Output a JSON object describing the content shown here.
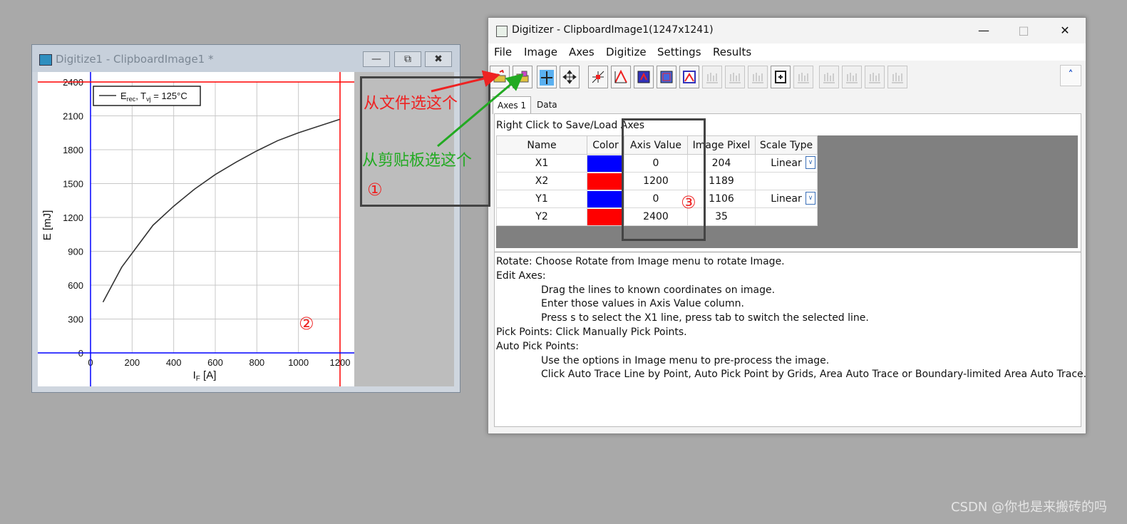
{
  "child_window": {
    "title": "Digitize1 - ClipboardImage1 *",
    "buttons": [
      {
        "name": "minimize",
        "glyph": "—"
      },
      {
        "name": "restore",
        "glyph": "⧉"
      },
      {
        "name": "close",
        "glyph": "✖"
      }
    ]
  },
  "chart_data": {
    "type": "line",
    "series": [
      {
        "name": "E_rec, T_vj = 125°C",
        "x": [
          60,
          150,
          300,
          400,
          500,
          600,
          700,
          800,
          900,
          1000,
          1100,
          1200
        ],
        "y": [
          450,
          760,
          1130,
          1300,
          1450,
          1580,
          1690,
          1790,
          1880,
          1950,
          2010,
          2070
        ]
      }
    ],
    "legend": {
      "text_main": "E",
      "sub1": "rec",
      "text_mid": ", T",
      "sub2": "vj",
      "text_end": " = 125°C",
      "position": "top-left"
    },
    "xlabel": {
      "main": "I",
      "sub": "F",
      "rest": " [A]"
    },
    "ylabel": "E [mJ]",
    "xlim": [
      0,
      1200
    ],
    "ylim": [
      0,
      2400
    ],
    "x_ticks": [
      "0",
      "200",
      "400",
      "600",
      "800",
      "1000",
      "1200"
    ],
    "y_ticks": [
      "0",
      "300",
      "600",
      "900",
      "1200",
      "1500",
      "1800",
      "2100",
      "2400"
    ],
    "grid": true,
    "line_color": "#333333",
    "axis_line_colors": {
      "x1": "#0000ff",
      "x2": "#ff0000",
      "y1": "#0000ff",
      "y2": "#ff0000"
    }
  },
  "main_window": {
    "title": "Digitizer - ClipboardImage1(1247x1241)",
    "window_controls": {
      "minimize": "—",
      "maximize": "□",
      "close": "✕"
    },
    "menu": [
      "File",
      "Image",
      "Axes",
      "Digitize",
      "Settings",
      "Results"
    ],
    "toolbar_icons": [
      "open-file-icon",
      "paste-clipboard-icon",
      "edit-axes-icon",
      "move-axes-icon",
      "manual-pick-icon",
      "auto-trace-icon",
      "pick-grid-icon",
      "area-trace-icon",
      "boundary-trace-icon",
      "disabled-icon-1",
      "disabled-icon-2",
      "disabled-icon-3",
      "fit-page-icon",
      "disabled-icon-4",
      "disabled-icon-5",
      "disabled-icon-6",
      "disabled-icon-7",
      "disabled-icon-8"
    ],
    "collapse_glyph": "˄",
    "tabs": [
      "Axes 1",
      "Data"
    ],
    "hint": "Right Click to Save/Load Axes",
    "table": {
      "headers": [
        "Name",
        "Color",
        "Axis Value",
        "Image Pixel",
        "Scale Type"
      ],
      "rows": [
        {
          "name": "X1",
          "color": "#0000ff",
          "axis_value": "0",
          "image_pixel": "204",
          "scale": "Linear"
        },
        {
          "name": "X2",
          "color": "#ff0000",
          "axis_value": "1200",
          "image_pixel": "1189",
          "scale": ""
        },
        {
          "name": "Y1",
          "color": "#0000ff",
          "axis_value": "0",
          "image_pixel": "1106",
          "scale": "Linear"
        },
        {
          "name": "Y2",
          "color": "#ff0000",
          "axis_value": "2400",
          "image_pixel": "35",
          "scale": ""
        }
      ]
    },
    "help": [
      {
        "text": "Rotate: Choose Rotate from Image menu to rotate Image.",
        "indent": false
      },
      {
        "text": "Edit Axes:",
        "indent": false
      },
      {
        "text": "Drag the lines to known coordinates on image.",
        "indent": true
      },
      {
        "text": "Enter those values in Axis Value column.",
        "indent": true
      },
      {
        "text": "Press s to select the X1 line, press tab to switch the selected line.",
        "indent": true
      },
      {
        "text": "Pick Points: Click Manually Pick Points.",
        "indent": false
      },
      {
        "text": "Auto Pick Points:",
        "indent": false
      },
      {
        "text": "Use the options in Image menu to pre-process the image.",
        "indent": true
      },
      {
        "text": "Click Auto Trace Line by Point, Auto Pick Point by Grids, Area Auto Trace or Boundary-limited Area Auto Trace.",
        "indent": true
      }
    ]
  },
  "annotations": {
    "red_text": "从文件选这个",
    "green_text": "从剪贴板选这个",
    "circle1": "①",
    "circle2": "②",
    "circle3": "③",
    "red_color": "#ee2222",
    "green_color": "#22aa22"
  },
  "watermark": "CSDN @你也是来搬砖的吗"
}
